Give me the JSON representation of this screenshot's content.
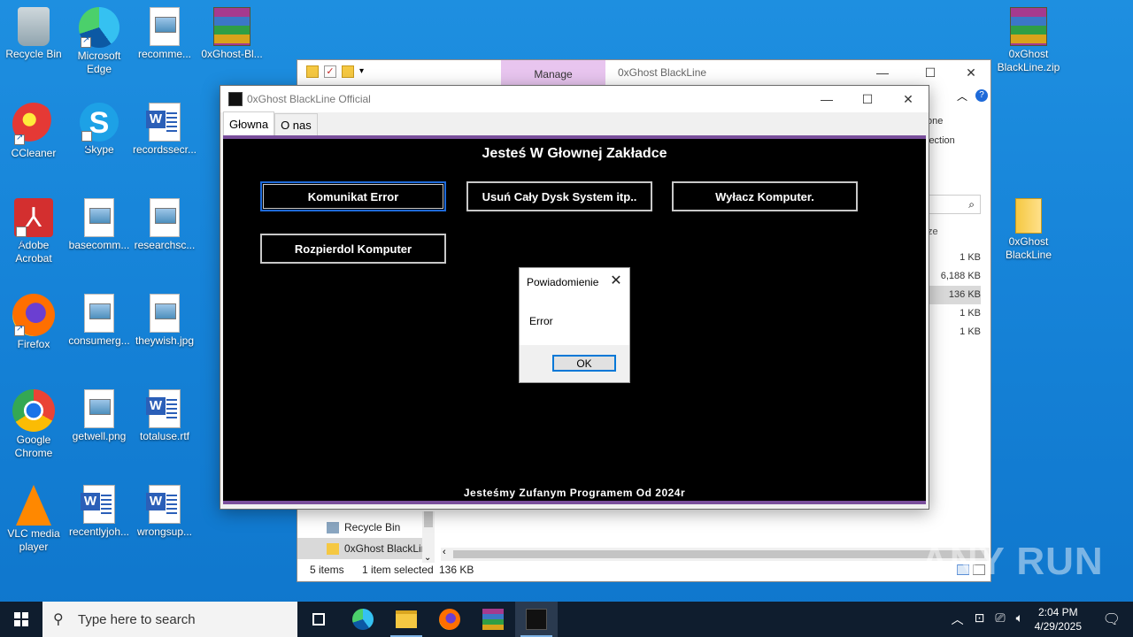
{
  "desktop": {
    "icons": [
      {
        "label": "Recycle Bin",
        "icon": "recycle-bin-icon"
      },
      {
        "label": "Microsoft Edge",
        "icon": "edge-icon"
      },
      {
        "label": "recomme...",
        "icon": "image-file-icon"
      },
      {
        "label": "0xGhost-Bl...",
        "icon": "winrar-archive-icon"
      },
      {
        "label": "CCleaner",
        "icon": "ccleaner-icon"
      },
      {
        "label": "Skype",
        "icon": "skype-icon"
      },
      {
        "label": "recordssecr...",
        "icon": "word-document-icon"
      },
      {
        "label": "Adobe Acrobat",
        "icon": "acrobat-icon"
      },
      {
        "label": "basecomm...",
        "icon": "image-file-icon"
      },
      {
        "label": "researchsc...",
        "icon": "image-file-icon"
      },
      {
        "label": "Firefox",
        "icon": "firefox-icon"
      },
      {
        "label": "consumerg...",
        "icon": "image-file-icon"
      },
      {
        "label": "theywish.jpg",
        "icon": "image-file-icon"
      },
      {
        "label": "Google Chrome",
        "icon": "chrome-icon"
      },
      {
        "label": "getwell.png",
        "icon": "image-file-icon"
      },
      {
        "label": "totaluse.rtf",
        "icon": "word-document-icon"
      },
      {
        "label": "VLC media player",
        "icon": "vlc-icon"
      },
      {
        "label": "recentlyjoh...",
        "icon": "word-document-icon"
      },
      {
        "label": "wrongsup...",
        "icon": "word-document-icon"
      },
      {
        "label": "0xGhost BlackLine.zip",
        "icon": "winrar-archive-icon"
      },
      {
        "label": "0xGhost BlackLine",
        "icon": "folder-icon"
      }
    ]
  },
  "explorer": {
    "manage_tab": "Manage",
    "title": "0xGhost BlackLine",
    "ribbon_fragments": [
      "one",
      "lection"
    ],
    "column_fragment": "ze",
    "sizes": [
      "1 KB",
      "6,188 KB",
      "136 KB",
      "1 KB",
      "1 KB"
    ],
    "nav_items": [
      "Recycle Bin",
      "0xGhost BlackLine"
    ],
    "status": {
      "items": "5 items",
      "selected": "1 item selected",
      "size": "136 KB"
    }
  },
  "app": {
    "title": "0xGhost BlackLine Official",
    "tabs": [
      "Głowna",
      "O nas"
    ],
    "heading": "Jesteś W Głownej Zakładce",
    "buttons": [
      "Komunikat Error",
      "Usuń Cały Dysk System itp..",
      "Wyłacz Komputer.",
      "Rozpierdol Komputer"
    ],
    "footer": "Jesteśmy Zufanym Programem Od 2024r"
  },
  "dialog": {
    "title": "Powiadomienie",
    "message": "Error",
    "ok_label": "OK"
  },
  "taskbar": {
    "search_placeholder": "Type here to search",
    "time": "2:04 PM",
    "date": "4/29/2025"
  },
  "watermark": "ANY RUN",
  "colors": {
    "desktop_bg": "#1683d8",
    "app_canvas": "#000000",
    "app_accent": "#7a4f9c",
    "manage_tab": "#e8c5ef",
    "dialog_ok_border": "#0078d7"
  }
}
